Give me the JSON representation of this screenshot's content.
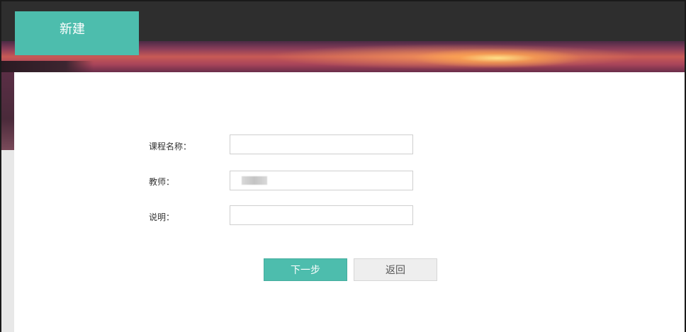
{
  "header": {
    "tab_label": "新建"
  },
  "form": {
    "course_name": {
      "label": "课程名称：",
      "value": "",
      "placeholder": ""
    },
    "teacher": {
      "label": "教师：",
      "placeholder": ""
    },
    "description": {
      "label": "说明：",
      "value": "",
      "placeholder": ""
    }
  },
  "actions": {
    "next_label": "下一步",
    "back_label": "返回"
  },
  "colors": {
    "accent": "#4dbdad",
    "header_dark": "#2e2e2e",
    "button_secondary": "#eeeeee"
  }
}
